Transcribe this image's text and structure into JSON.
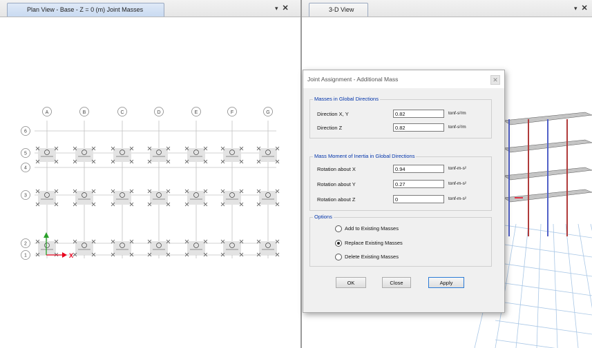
{
  "left_view": {
    "title": "Plan View - Base - Z = 0 (m)  Joint Masses",
    "menu_glyph": "▾",
    "close_glyph": "✕"
  },
  "right_view": {
    "title": "3-D View",
    "menu_glyph": "▾",
    "close_glyph": "✕"
  },
  "plan": {
    "column_grid": [
      "A",
      "B",
      "C",
      "D",
      "E",
      "F",
      "G"
    ],
    "row_grid": [
      "6",
      "5",
      "4",
      "3",
      "2",
      "1"
    ],
    "axis_x_label": "X",
    "axis_color": "#e8001c",
    "mass_color": "#3b3b3b"
  },
  "dialog": {
    "title": "Joint Assignment - Additional Mass",
    "close_glyph": "✕",
    "masses_group": {
      "legend": "Masses in Global Directions",
      "rows": [
        {
          "label": "Direction  X, Y",
          "value": "0.82",
          "unit": "tonf-s²/m"
        },
        {
          "label": "Direction  Z",
          "value": "0.82",
          "unit": "tonf-s²/m"
        }
      ]
    },
    "inertia_group": {
      "legend": "Mass Moment of Inertia in Global Directions",
      "rows": [
        {
          "label": "Rotation about  X",
          "value": "0.94",
          "unit": "tonf-m-s²"
        },
        {
          "label": "Rotation about  Y",
          "value": "0.27",
          "unit": "tonf-m-s²"
        },
        {
          "label": "Rotation about  Z",
          "value": "0",
          "unit": "tonf-m-s²"
        }
      ]
    },
    "options_group": {
      "legend": "Options",
      "choices": [
        "Add to Existing Masses",
        "Replace Existing Masses",
        "Delete Existing Masses"
      ],
      "selected": "Replace Existing Masses"
    },
    "buttons": {
      "ok": "OK",
      "close": "Close",
      "apply": "Apply"
    }
  }
}
